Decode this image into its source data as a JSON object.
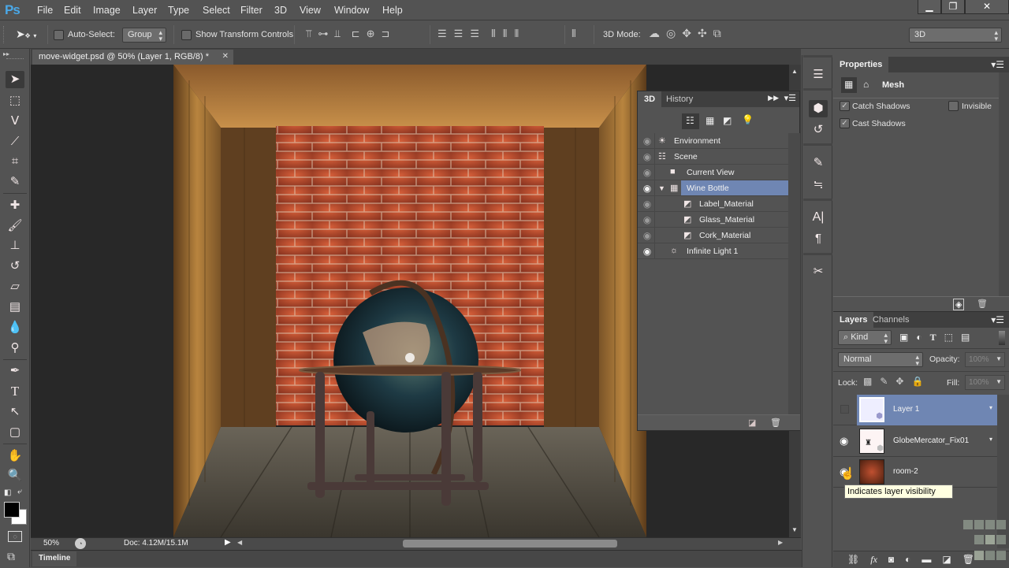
{
  "app": {
    "logo": "Ps",
    "menu": [
      "File",
      "Edit",
      "Image",
      "Layer",
      "Type",
      "Select",
      "Filter",
      "3D",
      "View",
      "Window",
      "Help"
    ],
    "window_buttons": {
      "minimize": "▁",
      "restore": "❐",
      "close": "✕"
    }
  },
  "options_bar": {
    "auto_select_label": "Auto-Select:",
    "auto_select_checked": false,
    "auto_select_target": "Group",
    "show_transform_label": "Show Transform Controls",
    "show_transform_checked": false,
    "mode_3d_label": "3D Mode:",
    "workspace": "3D"
  },
  "document": {
    "tab_title": "move-widget.psd @ 50% (Layer 1, RGB/8) *",
    "zoom": "50%",
    "doc_info": "Doc: 4.12M/15.1M",
    "timeline_label": "Timeline"
  },
  "tools": [
    "move",
    "marquee",
    "lasso",
    "quick-select",
    "crop",
    "eyedropper",
    "healing",
    "brush",
    "clone-stamp",
    "history-brush",
    "eraser",
    "gradient",
    "blur",
    "dodge",
    "pen",
    "type",
    "path-select",
    "shape",
    "hand",
    "zoom"
  ],
  "panel_3d": {
    "tabs": [
      "3D",
      "History"
    ],
    "active_tab": "3D",
    "filter_icons": [
      "scene-icon",
      "mesh-icon",
      "material-icon",
      "light-icon"
    ],
    "items": [
      {
        "label": "Environment",
        "icon": "environment-icon",
        "visible": false,
        "indent": 0
      },
      {
        "label": "Scene",
        "icon": "scene-icon",
        "visible": false,
        "indent": 0
      },
      {
        "label": "Current View",
        "icon": "camera-icon",
        "visible": false,
        "indent": 1
      },
      {
        "label": "Wine Bottle",
        "icon": "mesh-icon",
        "visible": true,
        "indent": 1,
        "selected": true,
        "expanded": true
      },
      {
        "label": "Label_Material",
        "icon": "material-icon",
        "visible": false,
        "indent": 2
      },
      {
        "label": "Glass_Material",
        "icon": "material-icon",
        "visible": false,
        "indent": 2
      },
      {
        "label": "Cork_Material",
        "icon": "material-icon",
        "visible": false,
        "indent": 2
      },
      {
        "label": "Infinite Light 1",
        "icon": "light-icon",
        "visible": true,
        "indent": 1
      }
    ]
  },
  "properties": {
    "title": "Properties",
    "section": "Mesh",
    "catch_shadows": {
      "label": "Catch Shadows",
      "checked": true
    },
    "cast_shadows": {
      "label": "Cast Shadows",
      "checked": true
    },
    "invisible": {
      "label": "Invisible",
      "checked": false
    }
  },
  "layers_panel": {
    "tabs": [
      "Layers",
      "Channels"
    ],
    "active_tab": "Layers",
    "filter_kind": "Kind",
    "blend_mode": "Normal",
    "opacity_label": "Opacity:",
    "opacity": "100%",
    "lock_label": "Lock:",
    "fill_label": "Fill:",
    "fill": "100%",
    "layers": [
      {
        "name": "Layer 1",
        "visible": false,
        "selected": true,
        "type": "3d"
      },
      {
        "name": "GlobeMercator_Fix01",
        "visible": true,
        "selected": false,
        "type": "3d"
      },
      {
        "name": "room-2",
        "visible": true,
        "selected": false,
        "type": "image"
      }
    ],
    "tooltip": "Indicates layer visibility"
  },
  "colors": {
    "accent_selected": "#6f86b3",
    "logo": "#4aa8e8",
    "tooltip_bg": "#ffffe1"
  }
}
